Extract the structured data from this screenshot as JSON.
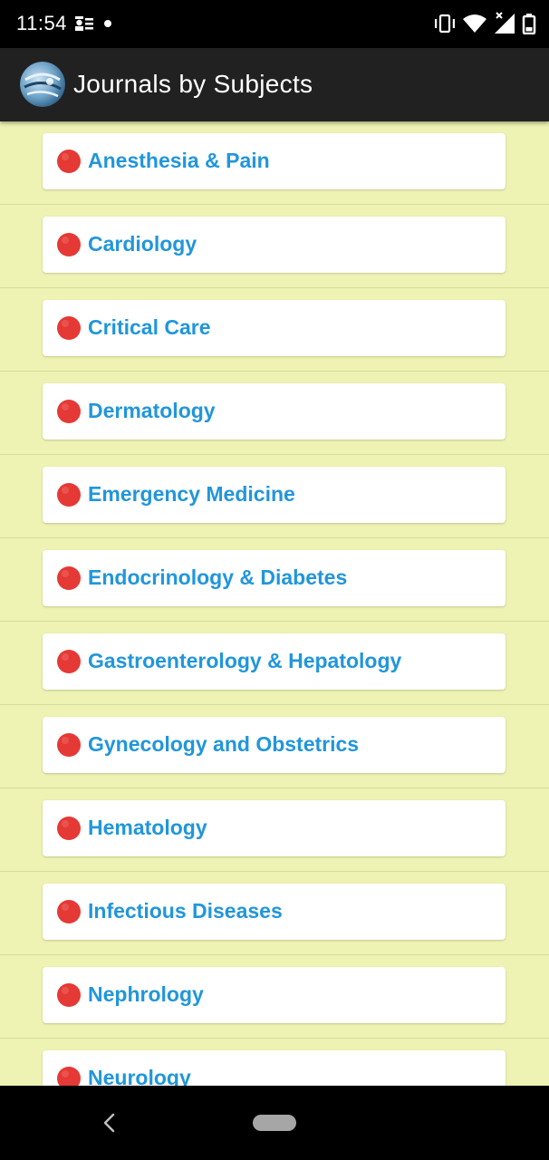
{
  "status_bar": {
    "time": "11:54",
    "left_icons": [
      "contact-card-icon",
      "notification-dot-icon"
    ],
    "right_icons": [
      "vibrate-icon",
      "wifi-icon",
      "no-signal-icon",
      "battery-icon"
    ]
  },
  "app_bar": {
    "logo_icon": "app-logo-icon",
    "title": "Journals by Subjects"
  },
  "colors": {
    "app_bar": "#212121",
    "background": "#eef2b2",
    "label": "#2196db",
    "dot": "#e53935"
  },
  "subjects": [
    {
      "label": "Anesthesia & Pain"
    },
    {
      "label": "Cardiology"
    },
    {
      "label": "Critical Care"
    },
    {
      "label": "Dermatology"
    },
    {
      "label": "Emergency Medicine"
    },
    {
      "label": "Endocrinology & Diabetes"
    },
    {
      "label": "Gastroenterology & Hepatology"
    },
    {
      "label": "Gynecology and Obstetrics"
    },
    {
      "label": "Hematology"
    },
    {
      "label": "Infectious Diseases"
    },
    {
      "label": "Nephrology"
    },
    {
      "label": "Neurology"
    }
  ],
  "nav_bar": {
    "back_icon": "back-chevron-icon",
    "home_icon": "home-pill-icon"
  }
}
